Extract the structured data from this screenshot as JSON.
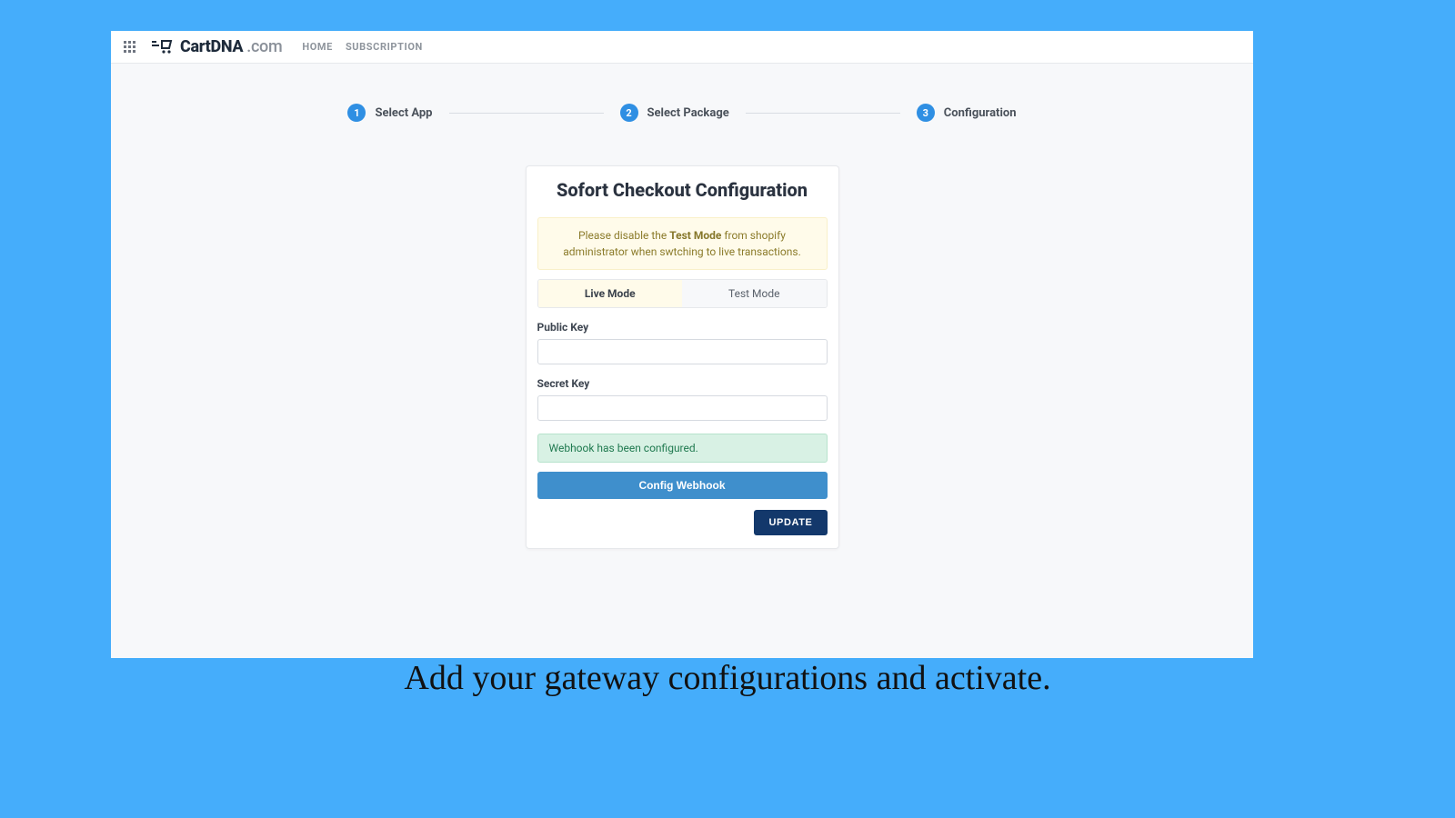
{
  "header": {
    "brand_name": "CartDNA",
    "brand_suffix": ".com",
    "nav": {
      "home": "HOME",
      "subscription": "SUBSCRIPTION"
    }
  },
  "stepper": {
    "steps": [
      {
        "num": "1",
        "label": "Select App"
      },
      {
        "num": "2",
        "label": "Select Package"
      },
      {
        "num": "3",
        "label": "Configuration"
      }
    ]
  },
  "card": {
    "title": "Sofort Checkout Configuration",
    "warning_pre": "Please disable the ",
    "warning_bold": "Test Mode",
    "warning_post": " from shopify administrator when swtching to live transactions.",
    "tabs": {
      "live": "Live Mode",
      "test": "Test Mode"
    },
    "fields": {
      "public_key_label": "Public Key",
      "public_key_value": "",
      "secret_key_label": "Secret Key",
      "secret_key_value": ""
    },
    "success_msg": "Webhook has been configured.",
    "config_webhook_btn": "Config Webhook",
    "update_btn": "UPDATE"
  },
  "caption": "Add your gateway configurations and activate."
}
